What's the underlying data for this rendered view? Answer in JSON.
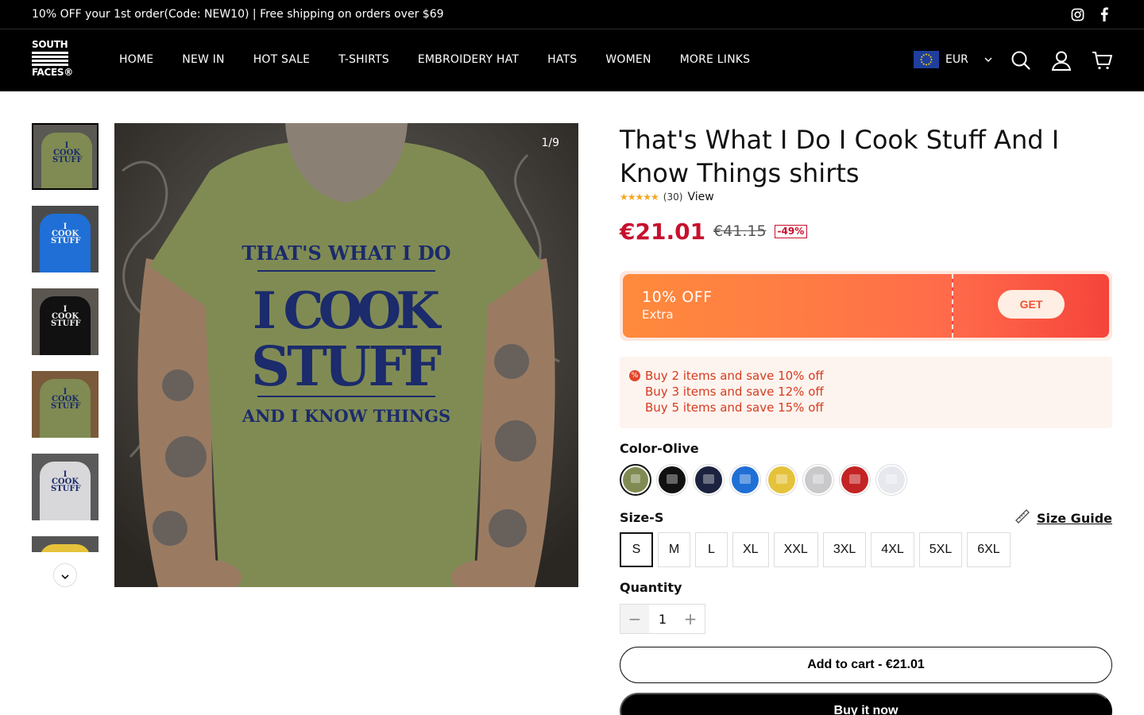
{
  "announcement": {
    "text": "10% OFF your 1st order(Code: NEW10) | Free shipping on orders over $69"
  },
  "social": {
    "icons": [
      "instagram-icon",
      "facebook-icon"
    ]
  },
  "header": {
    "logo_line1": "SOUTH",
    "logo_line2": "FACES®",
    "nav": [
      "HOME",
      "NEW IN",
      "HOT SALE",
      "T-SHIRTS",
      "EMBROIDERY HAT",
      "HATS",
      "WOMEN",
      "MORE LINKS"
    ],
    "currency": "EUR",
    "icons": [
      "search-icon",
      "account-icon",
      "cart-icon"
    ]
  },
  "gallery": {
    "counter": "1/9",
    "main_print": [
      "THAT'S WHAT I DO",
      "I COOK",
      "STUFF",
      "AND I KNOW THINGS"
    ],
    "thumb_print": [
      "I COOK",
      "STUFF"
    ]
  },
  "product": {
    "title": "That's What I Do I Cook Stuff And I Know Things shirts",
    "stars": "★★★★★",
    "review_count": "(30)",
    "view_label": "View",
    "price": "€21.01",
    "compare_price": "€41.15",
    "discount_badge": "-49%"
  },
  "coupon": {
    "title": "10% OFF",
    "subtitle": "Extra",
    "button": "GET"
  },
  "bundle": {
    "offers": [
      "Buy 2 items and save 10% off",
      "Buy 3 items and save 12% off",
      "Buy 5 items and save 15% off"
    ]
  },
  "options": {
    "color_label": "Color-Olive",
    "colors": [
      "#7f8b52",
      "#111111",
      "#1c2340",
      "#1f6fd6",
      "#e5c23a",
      "#c9c9cb",
      "#c42323",
      "#e6e8ee"
    ],
    "size_label": "Size-S",
    "size_guide": "Size Guide",
    "sizes": [
      "S",
      "M",
      "L",
      "XL",
      "XXL",
      "3XL",
      "4XL",
      "5XL",
      "6XL"
    ],
    "quantity_label": "Quantity",
    "quantity": "1"
  },
  "actions": {
    "add_to_cart": "Add to cart - €21.01",
    "buy_now": "Buy it now"
  }
}
